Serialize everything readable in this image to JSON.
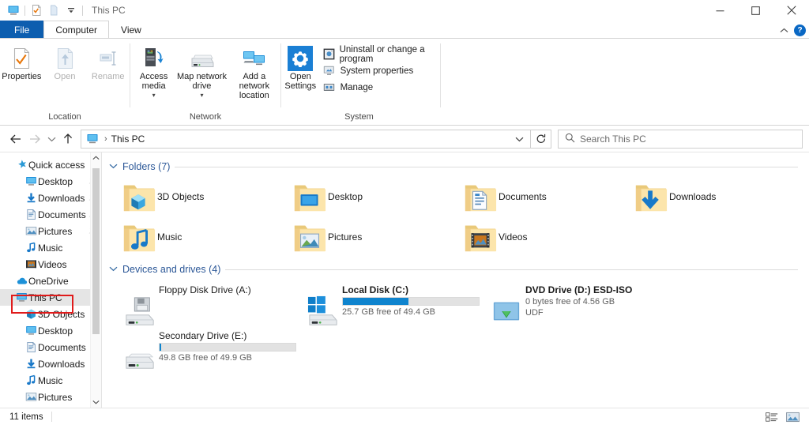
{
  "window": {
    "title": "This PC",
    "quick_access_toolbar": [
      {
        "name": "this-pc-icon",
        "label": "This PC"
      },
      {
        "name": "properties-icon",
        "label": "Properties"
      },
      {
        "name": "new-folder-icon",
        "label": "New folder"
      },
      {
        "name": "customize-dropdown-icon",
        "label": "Customize Quick Access Toolbar"
      }
    ],
    "controls": {
      "minimize": "Minimize",
      "maximize": "Maximize",
      "close": "Close"
    }
  },
  "tabs": [
    {
      "label": "File",
      "state": "file"
    },
    {
      "label": "Computer",
      "state": "active"
    },
    {
      "label": "View",
      "state": "inactive"
    }
  ],
  "tabstrip_right": {
    "collapse_ribbon": "Minimize the Ribbon",
    "help": "?"
  },
  "ribbon": {
    "groups": [
      {
        "name": "location",
        "label": "Location",
        "buttons": [
          {
            "label": "Properties",
            "icon": "properties-icon",
            "disabled": false
          },
          {
            "label": "Open",
            "icon": "open-icon",
            "disabled": true
          },
          {
            "label": "Rename",
            "icon": "rename-icon",
            "disabled": true
          }
        ]
      },
      {
        "name": "network",
        "label": "Network",
        "buttons": [
          {
            "label": "Access media",
            "icon": "access-media-icon",
            "dropdown": true
          },
          {
            "label": "Map network drive",
            "icon": "map-network-drive-icon",
            "dropdown": true
          },
          {
            "label": "Add a network location",
            "icon": "add-network-location-icon",
            "dropdown": false
          }
        ]
      },
      {
        "name": "system",
        "label": "System",
        "big_button": {
          "label": "Open Settings",
          "icon": "gear-icon"
        },
        "items": [
          {
            "label": "Uninstall or change a program",
            "icon": "uninstall-program-icon"
          },
          {
            "label": "System properties",
            "icon": "system-properties-icon"
          },
          {
            "label": "Manage",
            "icon": "manage-icon"
          }
        ]
      }
    ]
  },
  "addressbar": {
    "back": "Back",
    "forward": "Forward",
    "recent": "Recent locations",
    "up": "Up",
    "breadcrumb_icon": "this-pc-icon",
    "breadcrumb": "This PC",
    "separator": "›",
    "dropdown": "Previous locations",
    "refresh": "Refresh",
    "search_placeholder": "Search This PC",
    "search_value": ""
  },
  "sidebar": {
    "items": [
      {
        "label": "Quick access",
        "icon": "star-pin-icon",
        "indent": 0,
        "pinned": false,
        "selected": false
      },
      {
        "label": "Desktop",
        "icon": "desktop-icon",
        "indent": 1,
        "pinned": true,
        "selected": false
      },
      {
        "label": "Downloads",
        "icon": "downloads-icon",
        "indent": 1,
        "pinned": true,
        "selected": false
      },
      {
        "label": "Documents",
        "icon": "documents-icon",
        "indent": 1,
        "pinned": true,
        "selected": false
      },
      {
        "label": "Pictures",
        "icon": "pictures-icon",
        "indent": 1,
        "pinned": true,
        "selected": false
      },
      {
        "label": "Music",
        "icon": "music-icon",
        "indent": 1,
        "pinned": false,
        "selected": false
      },
      {
        "label": "Videos",
        "icon": "videos-icon",
        "indent": 1,
        "pinned": false,
        "selected": false
      },
      {
        "label": "OneDrive",
        "icon": "onedrive-icon",
        "indent": 0,
        "pinned": false,
        "selected": false
      },
      {
        "label": "This PC",
        "icon": "this-pc-icon",
        "indent": 0,
        "pinned": false,
        "selected": true
      },
      {
        "label": "3D Objects",
        "icon": "3d-objects-icon",
        "indent": 1,
        "pinned": false,
        "selected": false
      },
      {
        "label": "Desktop",
        "icon": "desktop-icon",
        "indent": 1,
        "pinned": false,
        "selected": false
      },
      {
        "label": "Documents",
        "icon": "documents-icon",
        "indent": 1,
        "pinned": false,
        "selected": false
      },
      {
        "label": "Downloads",
        "icon": "downloads-icon",
        "indent": 1,
        "pinned": false,
        "selected": false
      },
      {
        "label": "Music",
        "icon": "music-icon",
        "indent": 1,
        "pinned": false,
        "selected": false
      },
      {
        "label": "Pictures",
        "icon": "pictures-icon",
        "indent": 1,
        "pinned": false,
        "selected": false
      }
    ],
    "highlight": {
      "target": "This PC",
      "color": "#e01b1b"
    }
  },
  "content": {
    "folders_section": {
      "title": "Folders (7)",
      "chevron": "⌄",
      "items": [
        {
          "label": "3D Objects",
          "icon": "folder-3d-objects-icon"
        },
        {
          "label": "Desktop",
          "icon": "folder-desktop-icon"
        },
        {
          "label": "Documents",
          "icon": "folder-documents-icon"
        },
        {
          "label": "Downloads",
          "icon": "folder-downloads-icon"
        },
        {
          "label": "Music",
          "icon": "folder-music-icon"
        },
        {
          "label": "Pictures",
          "icon": "folder-pictures-icon"
        },
        {
          "label": "Videos",
          "icon": "folder-videos-icon"
        }
      ]
    },
    "devices_section": {
      "title": "Devices and drives (4)",
      "chevron": "⌄",
      "items": [
        {
          "name": "Floppy Disk Drive (A:)",
          "icon": "floppy-drive-icon",
          "bold": false,
          "has_bar": false,
          "bar_percent": 0,
          "sub": "",
          "sub2": ""
        },
        {
          "name": "Local Disk (C:)",
          "icon": "local-disk-windows-icon",
          "bold": true,
          "has_bar": true,
          "bar_percent": 48,
          "sub": "25.7 GB free of 49.4 GB",
          "sub2": ""
        },
        {
          "name": "DVD Drive (D:) ESD-ISO",
          "icon": "dvd-drive-icon",
          "bold": true,
          "has_bar": false,
          "bar_percent": 100,
          "sub": "0 bytes free of 4.56 GB",
          "sub2": "UDF"
        },
        {
          "name": "Secondary Drive (E:)",
          "icon": "hard-drive-icon",
          "bold": false,
          "has_bar": true,
          "bar_percent": 1,
          "sub": "49.8 GB free of 49.9 GB",
          "sub2": ""
        }
      ]
    }
  },
  "statusbar": {
    "item_count": "11 items",
    "view_buttons": [
      {
        "name": "details-view-button",
        "label": "Details view",
        "active": false
      },
      {
        "name": "large-icons-view-button",
        "label": "Large icons view",
        "active": true
      }
    ]
  },
  "colors": {
    "file_tab": "#0d5eaf",
    "section_title": "#2b5797",
    "disk_bar": "#0f84ce",
    "annotation": "#e01b1b",
    "selection": "#e5e5e5"
  }
}
